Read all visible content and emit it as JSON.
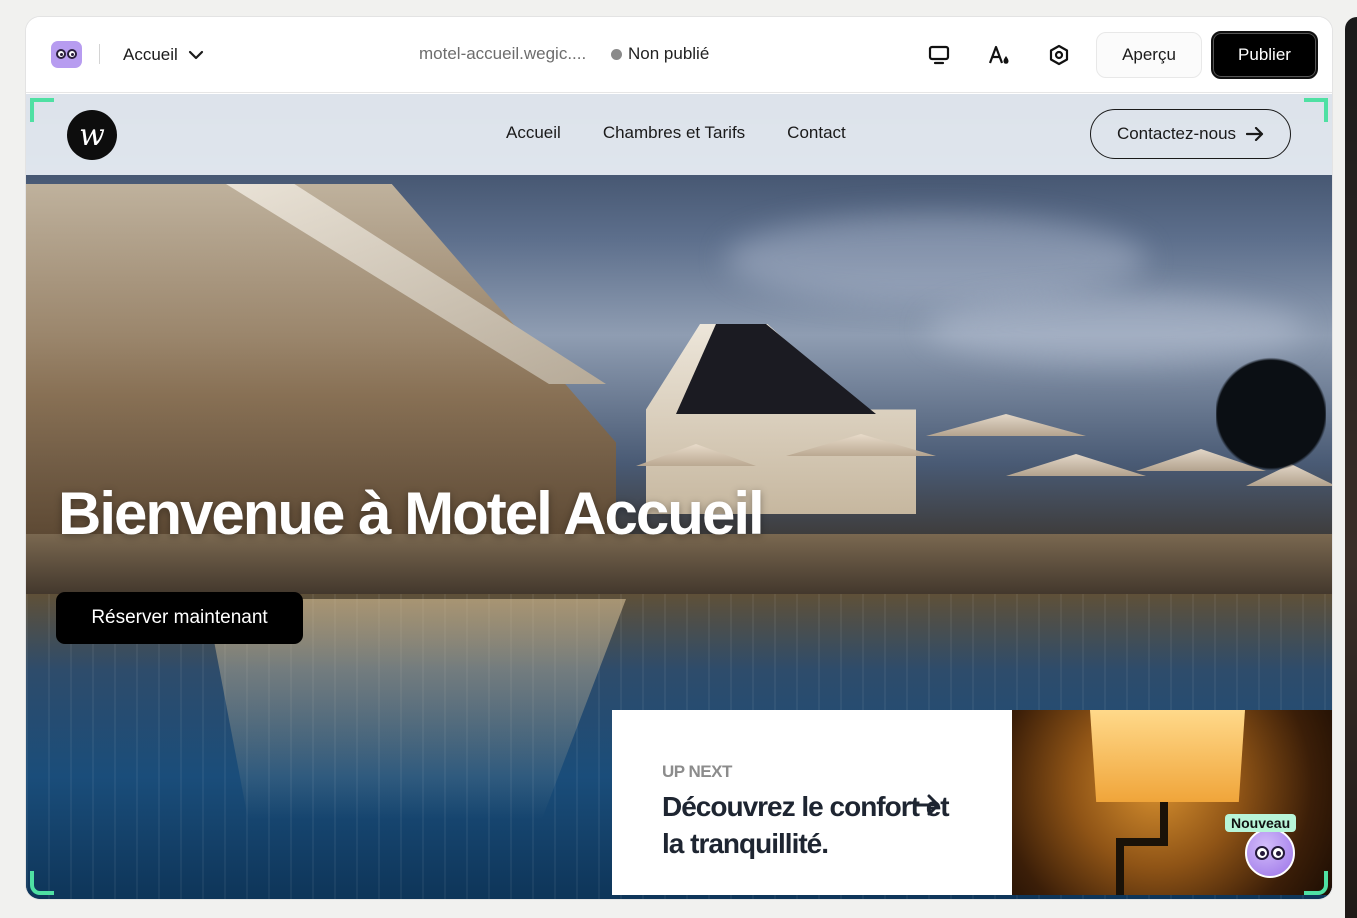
{
  "toolbar": {
    "page_name": "Accueil",
    "url": "motel-accueil.wegic....",
    "status": "Non publié",
    "preview_label": "Aperçu",
    "publish_label": "Publier",
    "icons": [
      "app-logo-icon",
      "chevron-down-icon",
      "desktop-icon",
      "style-icon",
      "settings-icon"
    ]
  },
  "site": {
    "logo_letter": "w",
    "nav": [
      "Accueil",
      "Chambres et Tarifs",
      "Contact"
    ],
    "contact_button": "Contactez-nous",
    "hero_title": "Bienvenue à Motel Accueil",
    "book_button": "Réserver maintenant",
    "upnext": {
      "label": "UP NEXT",
      "title": "Découvrez le confort et la tranquillité."
    }
  },
  "assistant": {
    "badge": "Nouveau"
  },
  "colors": {
    "publish_bg": "#000000",
    "selection_corner": "#4fe0a3",
    "assistant_purple": "#9a72e8",
    "badge_green": "#b8f5d8"
  }
}
